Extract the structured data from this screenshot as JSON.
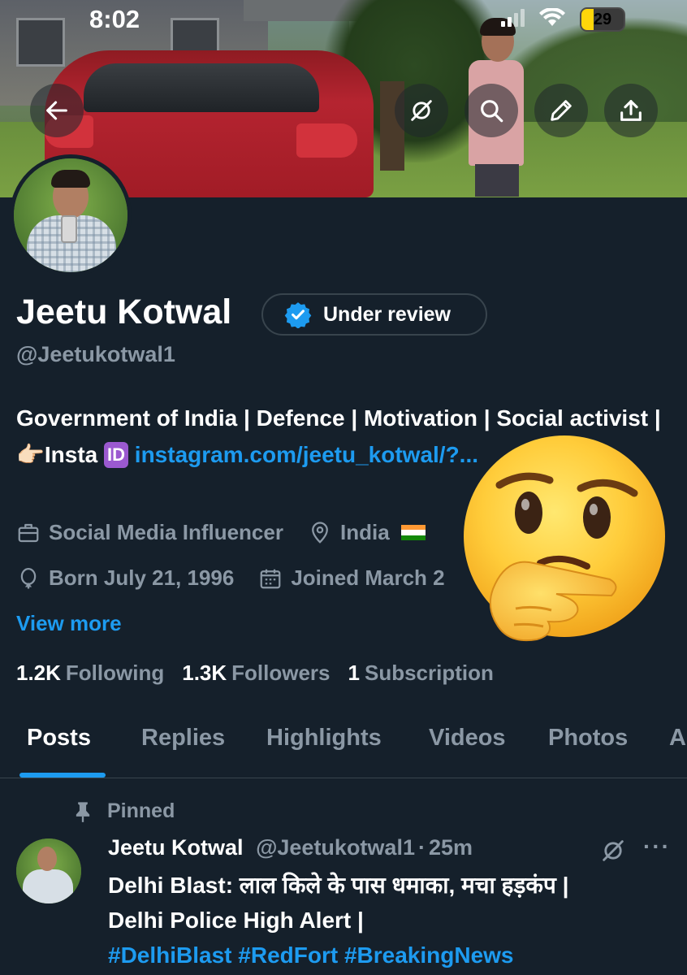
{
  "status_bar": {
    "time": "8:02",
    "battery_label": "29",
    "battery_level": 0.29
  },
  "top_actions": {
    "back_icon": "arrow-left-icon",
    "grok_icon": "grok-icon",
    "search_icon": "search-icon",
    "edit_icon": "pencil-icon",
    "share_icon": "share-icon"
  },
  "profile": {
    "display_name": "Jeetu Kotwal",
    "verification_label": "Under review",
    "handle": "@Jeetukotwal1",
    "bio_text_1": "Government of India | Defence | Motivation | Social activist | 👉🏻",
    "bio_text_2": "Insta",
    "bio_id_badge": "ID",
    "bio_link": "instagram.com/jeetu_kotwal/?...",
    "category": "Social Media Influencer",
    "location": "India",
    "birthday": "Born July 21, 1996",
    "joined": "Joined March 2",
    "view_more": "View more",
    "following_count": "1.2K",
    "following_label": "Following",
    "followers_count": "1.3K",
    "followers_label": "Followers",
    "subscriptions_count": "1",
    "subscriptions_label": "Subscription"
  },
  "tabs": [
    {
      "label": "Posts",
      "active": true
    },
    {
      "label": "Replies",
      "active": false
    },
    {
      "label": "Highlights",
      "active": false
    },
    {
      "label": "Videos",
      "active": false
    },
    {
      "label": "Photos",
      "active": false
    },
    {
      "label": "A",
      "active": false
    }
  ],
  "pinned_post": {
    "pinned_label": "Pinned",
    "author_name": "Jeetu Kotwal",
    "author_handle": "@Jeetukotwal1",
    "separator": "·",
    "time_ago": "25m",
    "more": "···",
    "line_1": "Delhi Blast: लाल किले के पास धमाका, मचा हड़कंप |",
    "line_2": "Delhi Police High Alert |",
    "hashtags": "#DelhiBlast #RedFort #BreakingNews"
  },
  "overlay": {
    "emoji_icon": "thinking-face-emoji"
  },
  "colors": {
    "background": "#15202b",
    "accent": "#1d9bf0",
    "secondary_text": "#8b98a5",
    "border": "#38444d",
    "battery": "#ffd60a"
  }
}
